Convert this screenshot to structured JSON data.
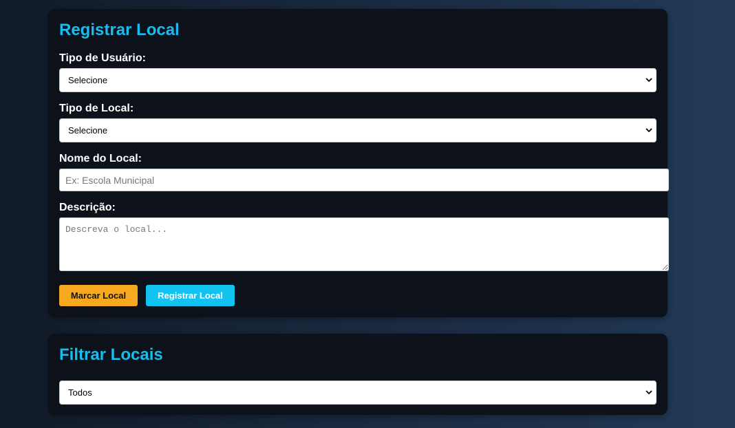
{
  "register": {
    "title": "Registrar Local",
    "user_type_label": "Tipo de Usuário:",
    "user_type_value": "Selecione",
    "place_type_label": "Tipo de Local:",
    "place_type_value": "Selecione",
    "name_label": "Nome do Local:",
    "name_placeholder": "Ex: Escola Municipal",
    "name_value": "",
    "description_label": "Descrição:",
    "description_placeholder": "Descreva o local...",
    "description_value": "",
    "mark_button": "Marcar Local",
    "register_button": "Registrar Local"
  },
  "filter": {
    "title": "Filtrar Locais",
    "filter_value": "Todos"
  },
  "colors": {
    "accent_title": "#18bcef",
    "mark_button_bg": "#f6a81f",
    "register_button_bg": "#12c2f0",
    "card_bg": "#0c111a"
  },
  "icons": {
    "dropdown": "chevron-down-icon"
  }
}
